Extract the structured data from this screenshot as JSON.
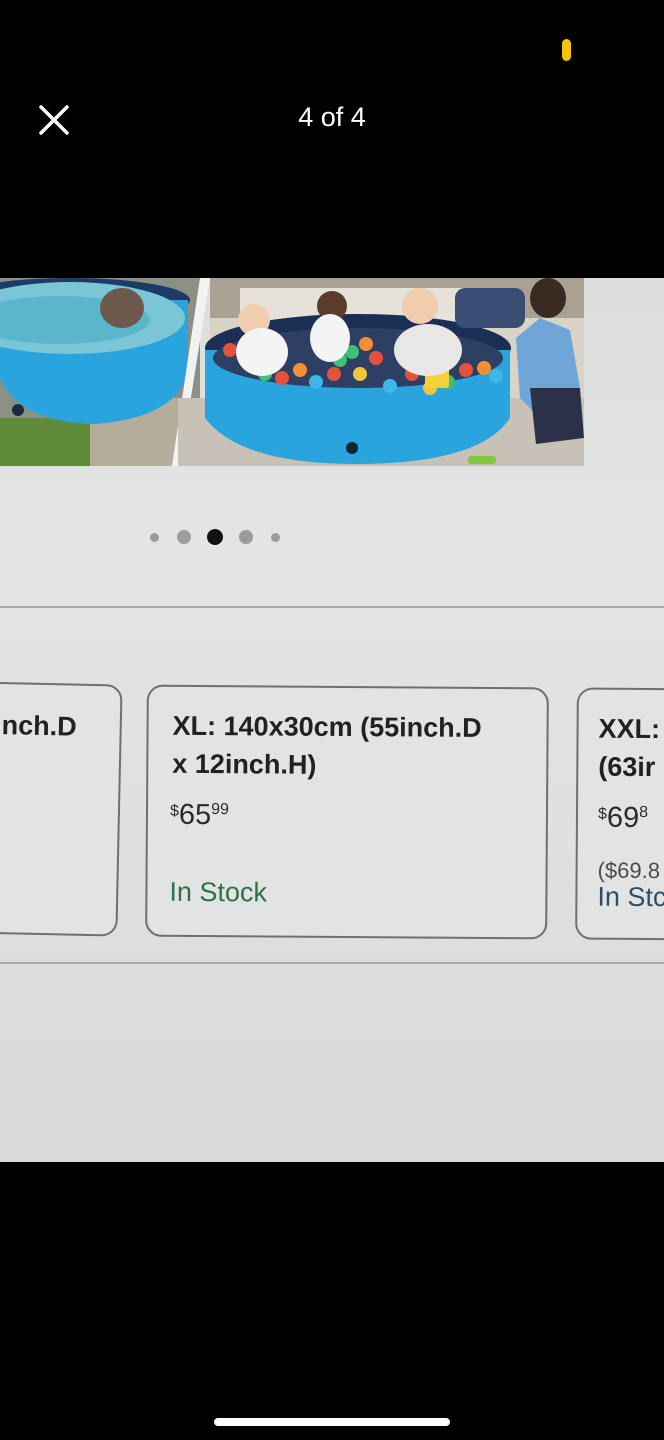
{
  "viewer": {
    "counter": "4 of 4",
    "close_icon": "close-icon"
  },
  "carousel": {
    "total_dots": 5,
    "active_index": 2
  },
  "size_options": {
    "left": {
      "title_fragment": "nch.D"
    },
    "xl": {
      "title_line1": "XL: 140x30cm (55inch.D",
      "title_line2": "x 12inch.H)",
      "price_currency": "$",
      "price_whole": "65",
      "price_cents": "99",
      "stock": "In Stock"
    },
    "xxl": {
      "title_line1": "XXL:",
      "title_line2": "(63ir",
      "price_currency": "$",
      "price_whole": "69",
      "price_cents": "8",
      "unit_price": "($69.8",
      "stock": "In Stc"
    }
  },
  "colors": {
    "stock_green": "#2f6f4a",
    "status_yellow": "#f5c400",
    "pool_blue": "#2aa4dc"
  }
}
